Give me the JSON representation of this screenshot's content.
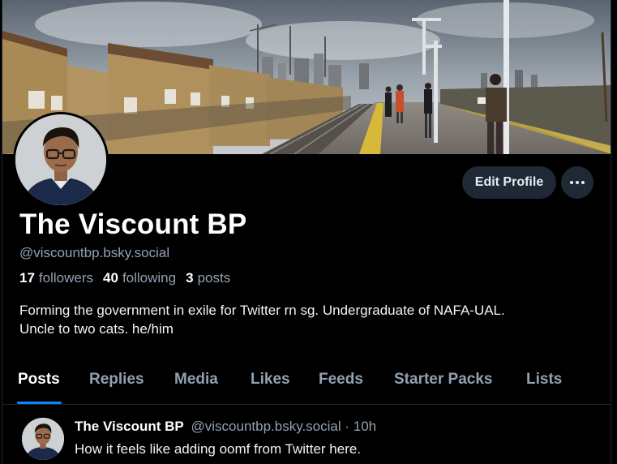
{
  "profile": {
    "display_name": "The Viscount BP",
    "handle": "@viscountbp.bsky.social",
    "followers_count": "17",
    "followers_label": "followers",
    "following_count": "40",
    "following_label": "following",
    "posts_count": "3",
    "posts_label": "posts",
    "bio_line1": "Forming the government in exile for Twitter rn sg. Undergraduate of NAFA-UAL.",
    "bio_line2": "Uncle to two cats. he/him"
  },
  "actions": {
    "edit_profile_label": "Edit Profile",
    "more_icon": "ellipsis-icon"
  },
  "tabs": [
    {
      "label": "Posts",
      "active": true
    },
    {
      "label": "Replies",
      "active": false
    },
    {
      "label": "Media",
      "active": false
    },
    {
      "label": "Likes",
      "active": false
    },
    {
      "label": "Feeds",
      "active": false
    },
    {
      "label": "Starter Packs",
      "active": false
    },
    {
      "label": "Lists",
      "active": false
    }
  ],
  "post": {
    "author_name": "The Viscount BP",
    "author_handle": "@viscountbp.bsky.social",
    "time": "· 10h",
    "text": "How it feels like adding oomf from Twitter here."
  },
  "colors": {
    "background": "#000000",
    "accent": "#1083fe",
    "muted_text": "#92a1b0",
    "button_bg": "#1e2935"
  }
}
